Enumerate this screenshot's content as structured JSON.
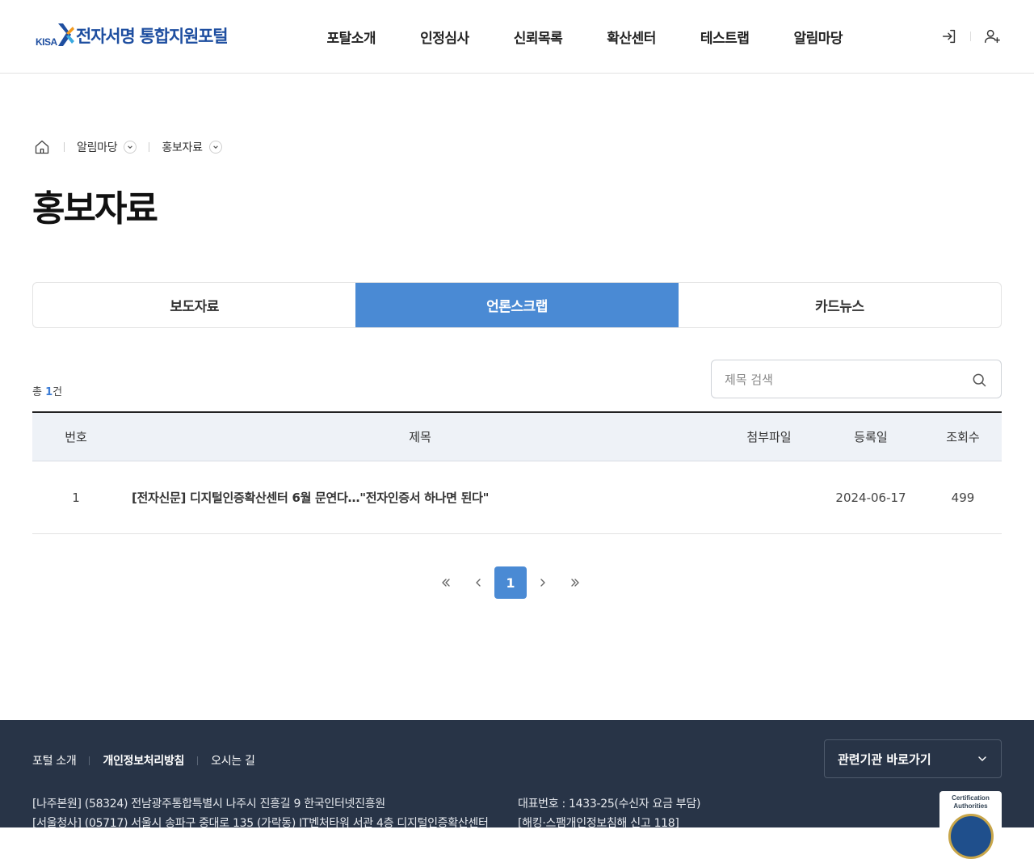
{
  "header": {
    "logo_mark": "KISA",
    "logo_text": "전자서명 통합지원포털",
    "nav": [
      "포탈소개",
      "인정심사",
      "신뢰목록",
      "확산센터",
      "테스트랩",
      "알림마당"
    ]
  },
  "breadcrumb": {
    "items": [
      "알림마당",
      "홍보자료"
    ]
  },
  "page_title": "홍보자료",
  "tabs": [
    {
      "label": "보도자료",
      "active": false
    },
    {
      "label": "언론스크랩",
      "active": true
    },
    {
      "label": "카드뉴스",
      "active": false
    }
  ],
  "list": {
    "count_prefix": "총",
    "count": "1",
    "count_suffix": "건",
    "search_placeholder": "제목 검색",
    "columns": {
      "no": "번호",
      "title": "제목",
      "file": "첨부파일",
      "date": "등록일",
      "views": "조회수"
    },
    "rows": [
      {
        "no": "1",
        "title": "[전자신문] 디지털인증확산센터 6월 문연다…\"전자인증서 하나면 된다\"",
        "file": "",
        "date": "2024-06-17",
        "views": "499"
      }
    ]
  },
  "pagination": {
    "current": "1"
  },
  "footer": {
    "links": [
      "포털 소개",
      "개인정보처리방침",
      "오시는 길"
    ],
    "address_1": "[나주본원] (58324) 전남광주통합특별시 나주시 진흥길 9 한국인터넷진흥원",
    "address_2": "[서울청사] (05717) 서울시 송파구 중대로 135 (가락동) IT벤처타워 서관 4층 디지털인증확산센터",
    "contact_1": "대표번호 : 1433-25(수신자 요금 부담)",
    "contact_2": "[해킹·스팸개인정보침해 신고 118]",
    "related_select": "관련기관 바로가기",
    "badge_text_1": "Certification",
    "badge_text_2": "Authorities"
  },
  "colors": {
    "accent": "#4a8ad4",
    "logo": "#1e4ea0",
    "footer_bg": "#283447"
  }
}
